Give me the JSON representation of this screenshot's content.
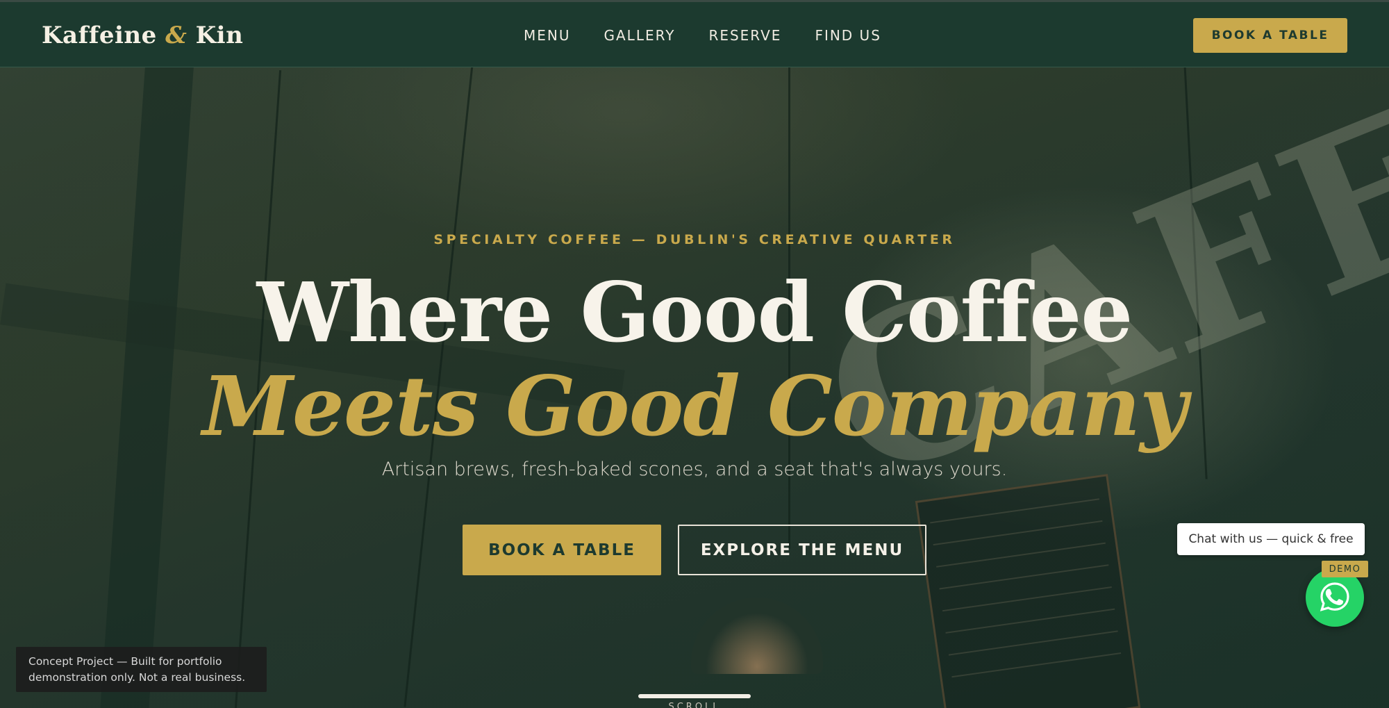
{
  "header": {
    "logo_part1": "Kaffeine",
    "logo_amp": "&",
    "logo_part2": "Kin",
    "nav": [
      {
        "label": "MENU"
      },
      {
        "label": "GALLERY"
      },
      {
        "label": "RESERVE"
      },
      {
        "label": "FIND US"
      }
    ],
    "cta_label": "BOOK A TABLE"
  },
  "hero": {
    "eyebrow": "SPECIALTY COFFEE — DUBLIN'S CREATIVE QUARTER",
    "headline_line1": "Where Good Coffee",
    "headline_line2": "Meets Good Company",
    "subhead": "Artisan brews, fresh-baked scones, and a seat that's always yours.",
    "primary_cta": "BOOK A TABLE",
    "secondary_cta": "EXPLORE THE MENU",
    "scroll_label": "SCROLL"
  },
  "chat": {
    "bubble_text": "Chat with us — quick & free",
    "badge": "DEMO",
    "icon": "whatsapp-icon"
  },
  "notice": {
    "line1": "Concept Project — Built for portfolio",
    "line2": "demonstration only. Not a real business."
  },
  "colors": {
    "brand_green": "#1c3a2f",
    "accent_gold": "#c9a94c",
    "cream": "#f7f3ea",
    "whatsapp_green": "#25d366"
  }
}
